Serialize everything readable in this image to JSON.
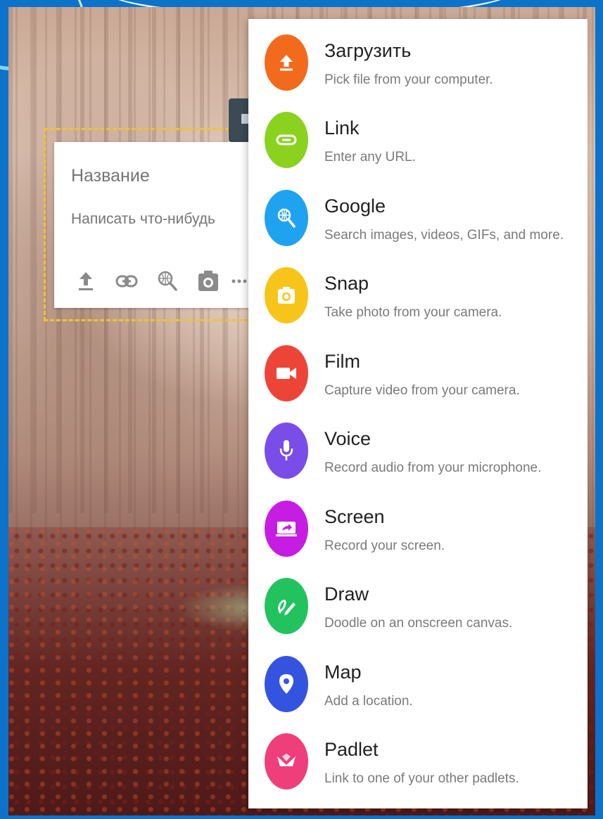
{
  "composer": {
    "title_placeholder": "Название",
    "body_placeholder": "Написать что-нибудь",
    "tools": [
      {
        "name": "upload-icon"
      },
      {
        "name": "link-icon"
      },
      {
        "name": "search-icon"
      },
      {
        "name": "camera-icon"
      },
      {
        "name": "more-icon"
      }
    ]
  },
  "menu": {
    "items": [
      {
        "label": "Загрузить",
        "description": "Pick file from your computer.",
        "icon": "upload-icon",
        "color": "#f26b1d"
      },
      {
        "label": "Link",
        "description": "Enter any URL.",
        "icon": "link-icon",
        "color": "#8bd21f"
      },
      {
        "label": "Google",
        "description": "Search images, videos, GIFs, and more.",
        "icon": "globe-search-icon",
        "color": "#1fa3f0"
      },
      {
        "label": "Snap",
        "description": "Take photo from your camera.",
        "icon": "camera-icon",
        "color": "#f7c51a"
      },
      {
        "label": "Film",
        "description": "Capture video from your camera.",
        "icon": "video-camera-icon",
        "color": "#ec4538"
      },
      {
        "label": "Voice",
        "description": "Record audio from your microphone.",
        "icon": "microphone-icon",
        "color": "#7a4de8"
      },
      {
        "label": "Screen",
        "description": "Record your screen.",
        "icon": "screen-share-icon",
        "color": "#c71de3"
      },
      {
        "label": "Draw",
        "description": "Doodle on an onscreen canvas.",
        "icon": "pencil-icon",
        "color": "#22c35e"
      },
      {
        "label": "Map",
        "description": "Add a location.",
        "icon": "map-pin-icon",
        "color": "#3454e0"
      },
      {
        "label": "Padlet",
        "description": "Link to one of your other padlets.",
        "icon": "padlet-logo-icon",
        "color": "#ef3f7b"
      }
    ]
  }
}
